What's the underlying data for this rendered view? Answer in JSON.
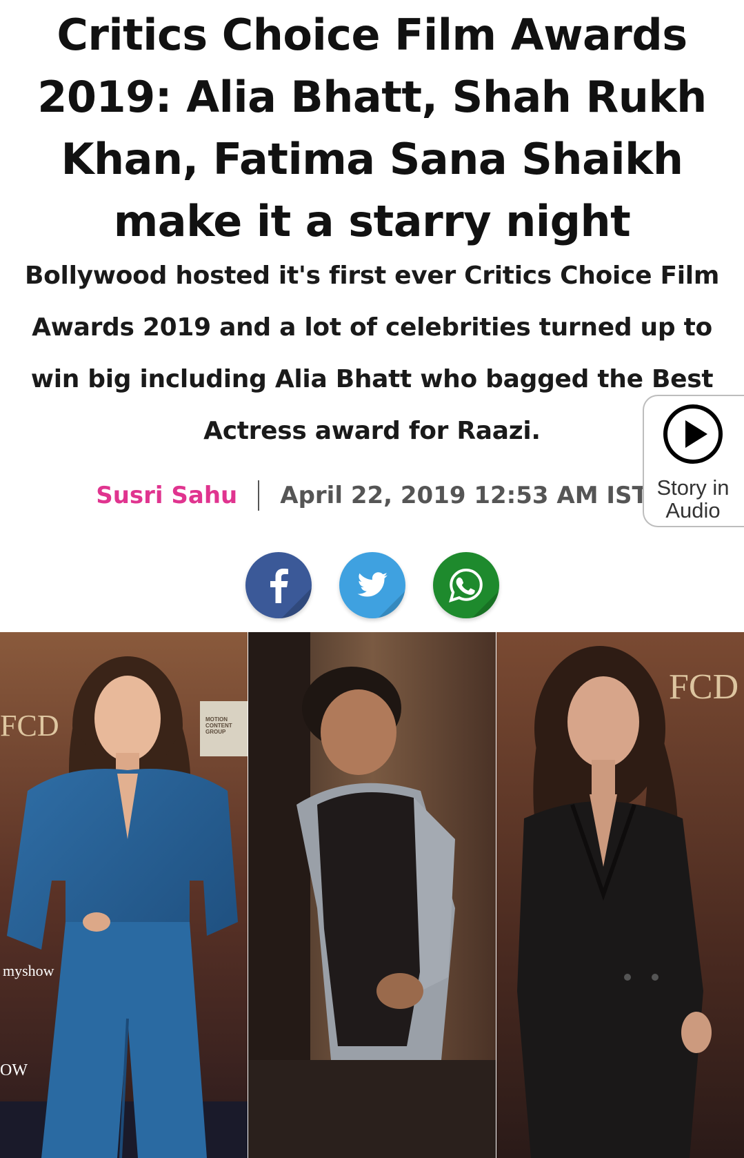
{
  "article": {
    "headline": "Critics Choice Film Awards 2019: Alia Bhatt, Shah Rukh Khan, Fatima Sana Shaikh make it a starry night",
    "summary": "Bollywood hosted it's first ever Critics Choice Film Awards 2019 and a lot of celebrities turned up to win big including Alia Bhatt who bagged the Best Actress award for Raazi.",
    "author": "Susri Sahu",
    "published": "April 22, 2019 12:53 AM IST"
  },
  "audio": {
    "label_line1": "Story in",
    "label_line2": "Audio",
    "icon": "play-circle-icon"
  },
  "share": [
    {
      "name": "facebook",
      "icon": "facebook-icon",
      "color": "#3b5998"
    },
    {
      "name": "twitter",
      "icon": "twitter-icon",
      "color": "#3fa1e0"
    },
    {
      "name": "whatsapp",
      "icon": "whatsapp-icon",
      "color": "#1e8a2d"
    }
  ],
  "photo": {
    "panels": [
      "alia-bhatt",
      "shah-rukh-khan",
      "fatima-sana-shaikh"
    ],
    "backdrop_text": {
      "left_logo": "FCD",
      "left_sponsor": "myshow",
      "left_bottom": "OW",
      "right_logo": "FCD",
      "motion_content": "MOTION CONTENT GROUP"
    }
  },
  "colors": {
    "author": "#e0348f",
    "headline": "#111111",
    "meta": "#555555"
  }
}
